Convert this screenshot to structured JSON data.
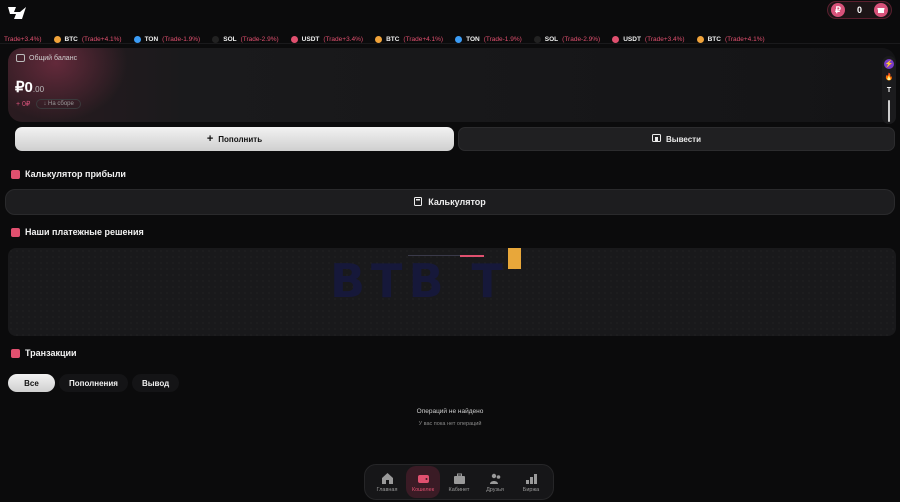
{
  "header": {
    "balance_coin_symbol": "₽",
    "balance_value": "0"
  },
  "ticker": [
    {
      "symbol": "",
      "change": "Trade+3.4%)",
      "color": "#e0506f"
    },
    {
      "symbol": "BTC",
      "change": "(Trade+4.1%)",
      "color": "#f0a33a"
    },
    {
      "symbol": "TON",
      "change": "(Trade-1.9%)",
      "color": "#3b9cf5"
    },
    {
      "symbol": "SOL",
      "change": "(Trade-2.9%)",
      "color": "#222222"
    },
    {
      "symbol": "USDT",
      "change": "(Trade+3.4%)",
      "color": "#e0506f"
    },
    {
      "symbol": "BTC",
      "change": "(Trade+4.1%)",
      "color": "#f0a33a"
    },
    {
      "symbol": "TON",
      "change": "(Trade-1.9%)",
      "color": "#3b9cf5"
    },
    {
      "symbol": "SOL",
      "change": "(Trade-2.9%)",
      "color": "#222222"
    },
    {
      "symbol": "USDT",
      "change": "(Trade+3.4%)",
      "color": "#e0506f"
    },
    {
      "symbol": "BTC",
      "change": "(Trade+4.1%)",
      "color": "#f0a33a"
    }
  ],
  "balance": {
    "label": "Общий баланс",
    "currency": "₽",
    "amount": "0",
    "cents": ".00",
    "plus_value": "+ 0₽",
    "chip_label": "↓ На сборе"
  },
  "actions": {
    "deposit_label": "Пополнить",
    "withdraw_label": "Вывести"
  },
  "calculator": {
    "section_title": "Калькулятор прибыли",
    "button_label": "Калькулятор"
  },
  "payments": {
    "section_title": "Наши платежные решения",
    "logo_text": "BTB T"
  },
  "transactions": {
    "section_title": "Транзакции",
    "tabs": [
      "Все",
      "Пополнения",
      "Вывод"
    ],
    "empty_title": "Операций не найдено",
    "empty_subtitle": "У вас пока нет операций"
  },
  "nav": [
    "Главная",
    "Кошелек",
    "Кабинет",
    "Друзья",
    "Биржа"
  ],
  "colors": {
    "accent": "#e0506f",
    "background": "#0b0b0c"
  }
}
